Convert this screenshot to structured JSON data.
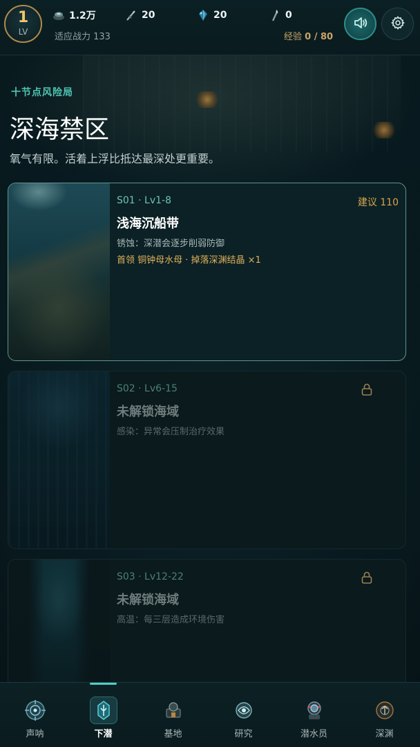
{
  "header": {
    "level": "1",
    "level_label": "LV",
    "resources": [
      {
        "icon": "coin-pile-icon",
        "value": "1.2万"
      },
      {
        "icon": "harpoon-icon",
        "value": "20"
      },
      {
        "icon": "crystal-icon",
        "value": "20"
      },
      {
        "icon": "torch-icon",
        "value": "0"
      }
    ],
    "power_label": "适应战力 133",
    "exp_prefix": "经验",
    "exp_value": "0 / 80",
    "sound_icon": "speaker-icon",
    "settings_icon": "gear-icon"
  },
  "intro": {
    "kicker": "十节点风险局",
    "title": "深海禁区",
    "subtitle": "氧气有限。活着上浮比抵达最深处更重要。"
  },
  "zones": [
    {
      "code": "S01 · Lv1-8",
      "recommend": "建议 110",
      "name": "浅海沉船带",
      "trait": "锈蚀：深潜会逐步削弱防御",
      "boss": "首领 铜钟母水母 · 掉落深渊结晶 ×1",
      "locked": false
    },
    {
      "code": "S02 · Lv6-15",
      "name": "未解锁海域",
      "trait": "感染：异常会压制治疗效果",
      "locked": true
    },
    {
      "code": "S03 · Lv12-22",
      "name": "未解锁海域",
      "trait": "高温：每三层造成环境伤害",
      "locked": true
    }
  ],
  "nav": [
    {
      "label": "声呐",
      "icon": "sonar-icon"
    },
    {
      "label": "下潜",
      "icon": "dive-icon",
      "active": true
    },
    {
      "label": "基地",
      "icon": "base-icon"
    },
    {
      "label": "研究",
      "icon": "research-icon"
    },
    {
      "label": "潜水员",
      "icon": "diver-icon"
    },
    {
      "label": "深渊",
      "icon": "abyss-icon"
    }
  ],
  "colors": {
    "accent": "#4fc3b3",
    "gold": "#d7a550",
    "background": "#061317"
  }
}
